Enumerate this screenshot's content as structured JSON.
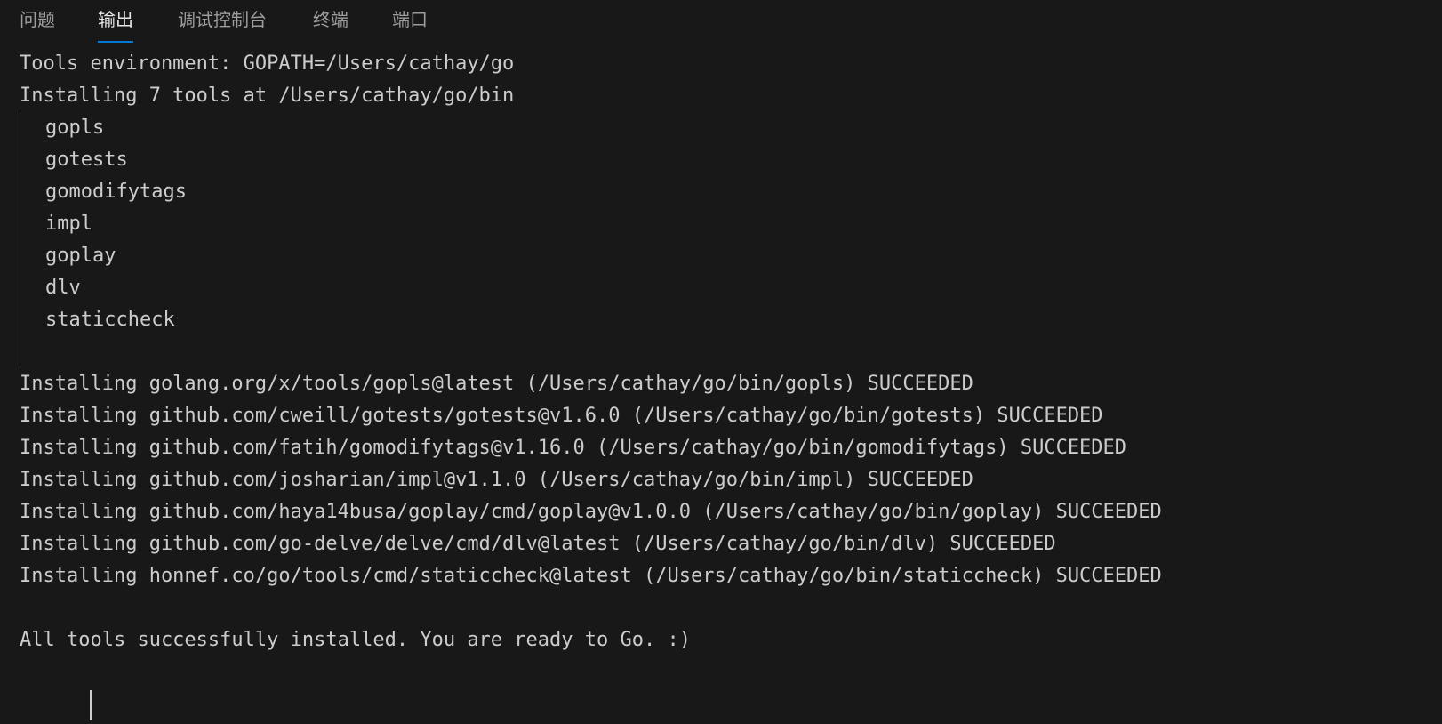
{
  "tabs": [
    {
      "label": "问题",
      "active": false
    },
    {
      "label": "输出",
      "active": true
    },
    {
      "label": "调试控制台",
      "active": false
    },
    {
      "label": "终端",
      "active": false
    },
    {
      "label": "端口",
      "active": false
    }
  ],
  "output": {
    "header_lines": [
      "Tools environment: GOPATH=/Users/cathay/go",
      "Installing 7 tools at /Users/cathay/go/bin"
    ],
    "tools": [
      "gopls",
      "gotests",
      "gomodifytags",
      "impl",
      "goplay",
      "dlv",
      "staticcheck"
    ],
    "install_lines": [
      "Installing golang.org/x/tools/gopls@latest (/Users/cathay/go/bin/gopls) SUCCEEDED",
      "Installing github.com/cweill/gotests/gotests@v1.6.0 (/Users/cathay/go/bin/gotests) SUCCEEDED",
      "Installing github.com/fatih/gomodifytags@v1.16.0 (/Users/cathay/go/bin/gomodifytags) SUCCEEDED",
      "Installing github.com/josharian/impl@v1.1.0 (/Users/cathay/go/bin/impl) SUCCEEDED",
      "Installing github.com/haya14busa/goplay/cmd/goplay@v1.0.0 (/Users/cathay/go/bin/goplay) SUCCEEDED",
      "Installing github.com/go-delve/delve/cmd/dlv@latest (/Users/cathay/go/bin/dlv) SUCCEEDED",
      "Installing honnef.co/go/tools/cmd/staticcheck@latest (/Users/cathay/go/bin/staticcheck) SUCCEEDED"
    ],
    "final_line": "All tools successfully installed. You are ready to Go. :)"
  },
  "colors": {
    "background": "#181818",
    "text": "#cccccc",
    "tab_active_underline": "#0078d4"
  }
}
